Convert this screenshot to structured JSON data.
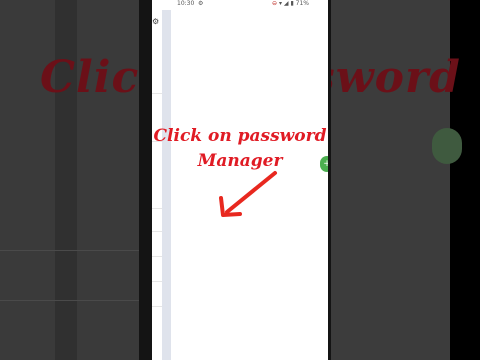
{
  "overlay": {
    "line1": "Click on password",
    "line2": "Manager"
  },
  "background_text": {
    "left": "Click",
    "right": "sword"
  },
  "status_bar": {
    "time": "10:30",
    "battery": "71%"
  },
  "colors": {
    "overlay_text": "#e01b24",
    "arrow": "#e8281f",
    "fab": "#4caf50"
  },
  "icons": [
    "gear-icon",
    "do-not-disturb-icon",
    "wifi-icon",
    "signal-icon",
    "battery-icon",
    "arrow-icon"
  ]
}
